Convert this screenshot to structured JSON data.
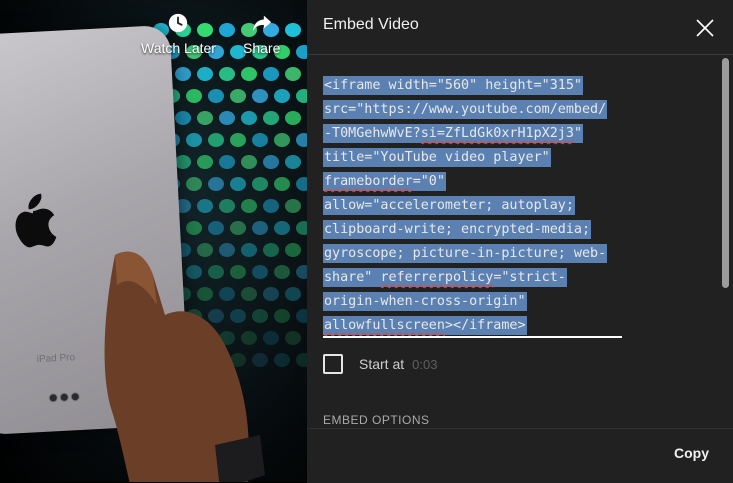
{
  "video": {
    "watch_later_label": "Watch Later",
    "share_label": "Share",
    "device_label": "iPad Pro"
  },
  "panel": {
    "title": "Embed Video",
    "code_lines": [
      "<iframe width=\"560\" height=\"315\"",
      "src=\"https://www.youtube.com/embed/",
      "-T0MGehwWvE?",
      "si=ZfLdGk0xrH1pX2j3",
      "\"",
      "title=\"YouTube video player\"",
      "frameborder",
      "=\"0\"",
      "allow=\"accelerometer; autoplay;",
      "clipboard-write; encrypted-media;",
      "gyroscope; picture-in-picture; web-",
      "share\" ",
      "referrerpolicy",
      "=\"strict-",
      "origin-when-cross-origin\"",
      "allowfullscreen",
      "></iframe>"
    ],
    "start_at_label": "Start at",
    "start_at_time": "0:03",
    "start_at_checked": false,
    "embed_options_label": "EMBED OPTIONS",
    "copy_label": "Copy"
  },
  "colors": {
    "panel_bg": "#212121",
    "selection": "#5b80b2",
    "spellcheck": "#e0443e"
  },
  "icons": [
    "clock-icon",
    "share-arrow-icon",
    "close-icon",
    "apple-logo-icon"
  ]
}
